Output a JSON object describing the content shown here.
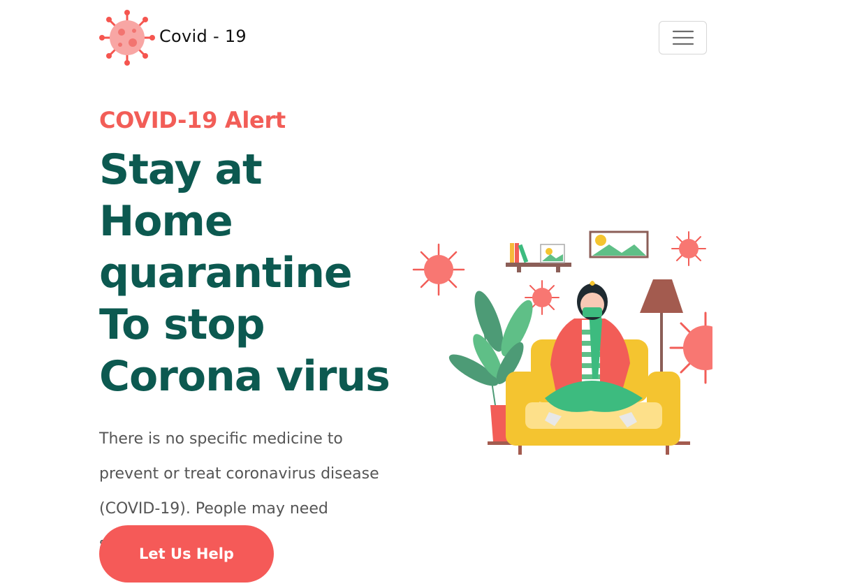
{
  "navbar": {
    "brand_text": "Covid - 19",
    "logo_icon": "virus-icon",
    "menu_icon": "hamburger-menu-icon"
  },
  "hero": {
    "alert": "COVID-19 Alert",
    "headline": "Stay at Home quarantine To stop Corona virus",
    "lead": "There is no specific medicine to prevent or treat coronavirus disease (COVID-19). People may need supportive care to .",
    "cta_label": "Let Us Help",
    "illustration": "woman-quarantine-illustration"
  },
  "colors": {
    "accent_red": "#f55a58",
    "heading_teal": "#0c5950",
    "body_text": "#555555"
  }
}
